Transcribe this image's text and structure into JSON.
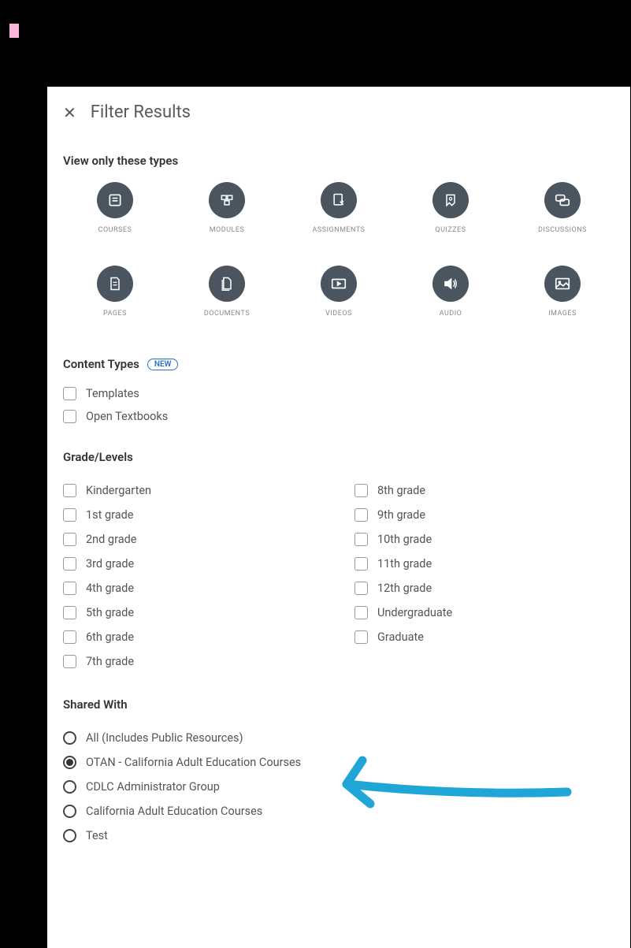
{
  "header": {
    "title": "Filter Results"
  },
  "types_section": {
    "label": "View only these types"
  },
  "types": [
    {
      "label": "COURSES"
    },
    {
      "label": "MODULES"
    },
    {
      "label": "ASSIGNMENTS"
    },
    {
      "label": "QUIZZES"
    },
    {
      "label": "DISCUSSIONS"
    },
    {
      "label": "PAGES"
    },
    {
      "label": "DOCUMENTS"
    },
    {
      "label": "VIDEOS"
    },
    {
      "label": "AUDIO"
    },
    {
      "label": "IMAGES"
    }
  ],
  "content_types": {
    "label": "Content Types",
    "badge": "NEW",
    "options": [
      {
        "label": "Templates"
      },
      {
        "label": "Open Textbooks"
      }
    ]
  },
  "grade_levels": {
    "label": "Grade/Levels",
    "col1": [
      {
        "label": "Kindergarten"
      },
      {
        "label": "1st grade"
      },
      {
        "label": "2nd grade"
      },
      {
        "label": "3rd grade"
      },
      {
        "label": "4th grade"
      },
      {
        "label": "5th grade"
      },
      {
        "label": "6th grade"
      },
      {
        "label": "7th grade"
      }
    ],
    "col2": [
      {
        "label": "8th grade"
      },
      {
        "label": "9th grade"
      },
      {
        "label": "10th grade"
      },
      {
        "label": "11th grade"
      },
      {
        "label": "12th grade"
      },
      {
        "label": "Undergraduate"
      },
      {
        "label": "Graduate"
      }
    ]
  },
  "shared_with": {
    "label": "Shared With",
    "selected": 1,
    "options": [
      {
        "label": "All (Includes Public Resources)"
      },
      {
        "label": "OTAN - California Adult Education Courses"
      },
      {
        "label": "CDLC Administrator Group"
      },
      {
        "label": "California Adult Education Courses"
      },
      {
        "label": "Test"
      }
    ]
  }
}
